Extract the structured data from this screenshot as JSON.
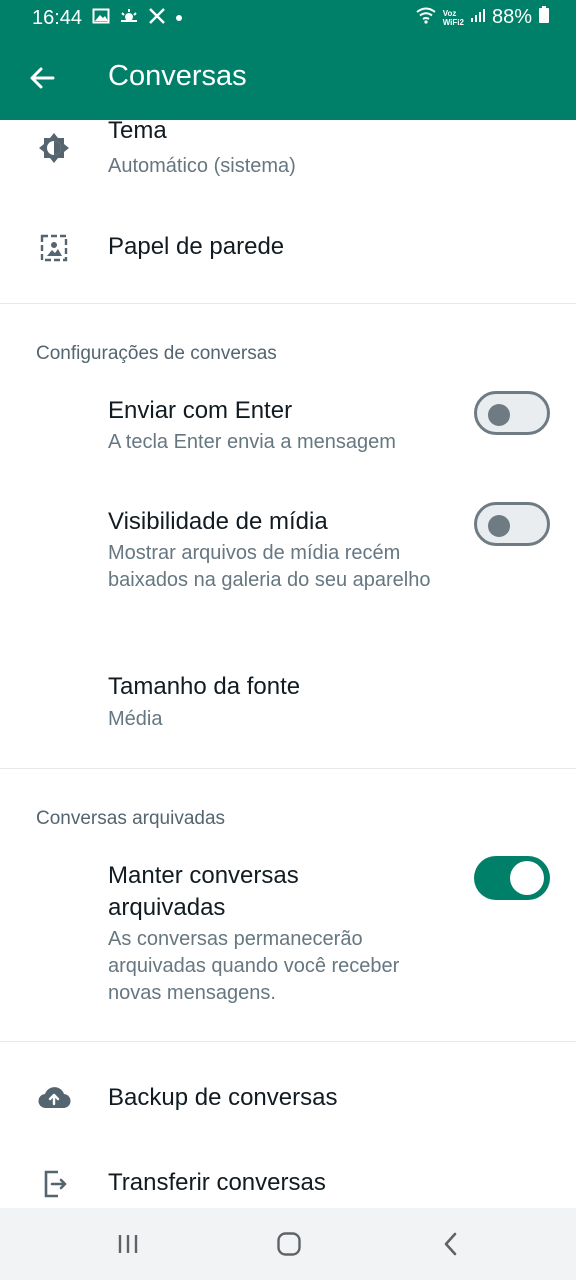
{
  "status_bar": {
    "time": "16:44",
    "battery": "88%",
    "network_label_top": "Voz",
    "network_label_bottom": "WiFi2"
  },
  "app_bar": {
    "title": "Conversas"
  },
  "display": {
    "theme_title": "Tema",
    "theme_value": "Automático (sistema)",
    "wallpaper_title": "Papel de parede"
  },
  "chat_settings": {
    "section_title": "Configurações de conversas",
    "enter_send_title": "Enviar com Enter",
    "enter_send_sub": "A tecla Enter envia a mensagem",
    "enter_send_on": false,
    "media_visibility_title": "Visibilidade de mídia",
    "media_visibility_sub": "Mostrar arquivos de mídia recém baixados na galeria do seu aparelho",
    "media_visibility_on": false,
    "font_size_title": "Tamanho da fonte",
    "font_size_value": "Média"
  },
  "archived": {
    "section_title": "Conversas arquivadas",
    "keep_archived_title": "Manter conversas arquivadas",
    "keep_archived_sub": "As conversas permanecerão arquivadas quando você receber novas mensagens.",
    "keep_archived_on": true
  },
  "other": {
    "backup_title": "Backup de conversas",
    "transfer_title": "Transferir conversas"
  },
  "colors": {
    "brand": "#008069",
    "toggle_off": "#6f7b83"
  }
}
